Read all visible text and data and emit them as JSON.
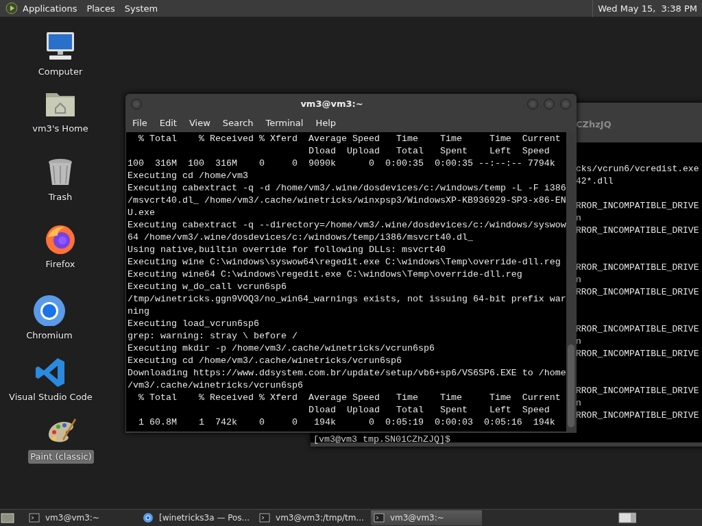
{
  "top_panel": {
    "menus": [
      "Applications",
      "Places",
      "System"
    ],
    "clock": "Wed May 15,  3:38 PM"
  },
  "desktop_icons": [
    {
      "kind": "computer",
      "label": "Computer",
      "selected": false
    },
    {
      "kind": "home",
      "label": "vm3's Home",
      "selected": false
    },
    {
      "kind": "trash",
      "label": "Trash",
      "selected": false
    },
    {
      "kind": "firefox",
      "label": "Firefox",
      "selected": false
    },
    {
      "kind": "chromium",
      "label": "Chromium",
      "selected": false
    },
    {
      "kind": "vscode",
      "label": "Visual Studio Code",
      "selected": false
    },
    {
      "kind": "paint",
      "label": "Paint (classic)",
      "selected": true
    }
  ],
  "back_terminal": {
    "title": "CZhzJQ",
    "blocks": [
      [
        "cks/vcrun6/vcredist.exe",
        "42*.dll"
      ],
      [
        "RROR_INCOMPATIBLE_DRIVE",
        "n",
        "RROR_INCOMPATIBLE_DRIVE"
      ],
      [
        "RROR_INCOMPATIBLE_DRIVE",
        "n",
        "RROR_INCOMPATIBLE_DRIVE"
      ],
      [
        "RROR_INCOMPATIBLE_DRIVE",
        "n",
        "RROR_INCOMPATIBLE_DRIVE"
      ],
      [
        "RROR_INCOMPATIBLE_DRIVE",
        "n",
        "RROR_INCOMPATIBLE_DRIVE"
      ]
    ],
    "prompt": "[vm3@vm3 tmp.SN01CZhZJQ]$"
  },
  "terminal": {
    "title": "vm3@vm3:~",
    "menus": [
      "File",
      "Edit",
      "View",
      "Search",
      "Terminal",
      "Help"
    ],
    "lines": [
      "  % Total    % Received % Xferd  Average Speed   Time    Time     Time  Current",
      "                                 Dload  Upload   Total   Spent    Left  Speed",
      "100  316M  100  316M    0     0  9090k      0  0:00:35  0:00:35 --:--:-- 7794k",
      "Executing cd /home/vm3",
      "Executing cabextract -q -d /home/vm3/.wine/dosdevices/c:/windows/temp -L -F i386",
      "/msvcrt40.dl_ /home/vm3/.cache/winetricks/winxpsp3/WindowsXP-KB936929-SP3-x86-EN",
      "U.exe",
      "Executing cabextract -q --directory=/home/vm3/.wine/dosdevices/c:/windows/syswow",
      "64 /home/vm3/.wine/dosdevices/c:/windows/temp/i386/msvcrt40.dl_",
      "Using native,builtin override for following DLLs: msvcrt40",
      "Executing wine C:\\windows\\syswow64\\regedit.exe C:\\windows\\Temp\\override-dll.reg",
      "Executing wine64 C:\\windows\\regedit.exe C:\\windows\\Temp\\override-dll.reg",
      "Executing w_do_call vcrun6sp6",
      "/tmp/winetricks.ggn9VOQ3/no_win64_warnings exists, not issuing 64-bit prefix war",
      "ning",
      "Executing load_vcrun6sp6",
      "grep: warning: stray \\ before /",
      "Executing mkdir -p /home/vm3/.cache/winetricks/vcrun6sp6",
      "Executing cd /home/vm3/.cache/winetricks/vcrun6sp6",
      "Downloading https://www.ddsystem.com.br/update/setup/vb6+sp6/VS6SP6.EXE to /home",
      "/vm3/.cache/winetricks/vcrun6sp6",
      "  % Total    % Received % Xferd  Average Speed   Time    Time     Time  Current",
      "                                 Dload  Upload   Total   Spent    Left  Speed",
      "  1 60.8M    1  742k    0     0   194k      0  0:05:19  0:00:03  0:05:16  194k"
    ]
  },
  "taskbar": {
    "items": [
      {
        "kind": "terminal",
        "label": "vm3@vm3:~",
        "selected": false
      },
      {
        "kind": "browser",
        "label": "[winetricks3a — Pos...",
        "selected": false
      },
      {
        "kind": "terminal",
        "label": "vm3@vm3:/tmp/tm...",
        "selected": false
      },
      {
        "kind": "terminal",
        "label": "vm3@vm3:~",
        "selected": true
      }
    ]
  }
}
